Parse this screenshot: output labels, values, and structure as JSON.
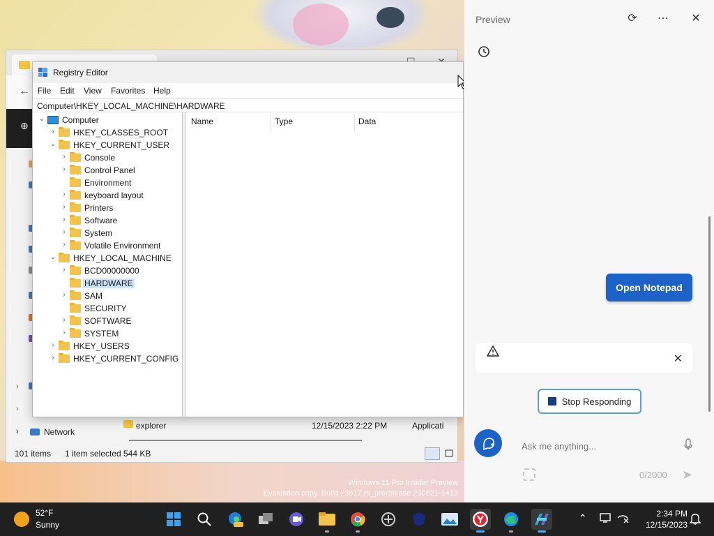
{
  "desktop": {
    "watermark_line1": "Windows 11 Pro Insider Preview",
    "watermark_line2": "Evaluation copy. Build 23617.rs_prerelease.230821-1413"
  },
  "explorer": {
    "sidebar_network": "Network",
    "file": {
      "name": "explorer",
      "date": "12/15/2023 2:22 PM",
      "type": "Applicati"
    },
    "status_items": "101 items",
    "status_selected": "1 item selected",
    "status_size": "544 KB"
  },
  "regedit": {
    "title": "Registry Editor",
    "menu": [
      "File",
      "Edit",
      "View",
      "Favorites",
      "Help"
    ],
    "address": "Computer\\HKEY_LOCAL_MACHINE\\HARDWARE",
    "columns": [
      "Name",
      "Type",
      "Data"
    ],
    "tree": [
      {
        "label": "Computer",
        "level": 0,
        "expanded": true,
        "icon": "computer"
      },
      {
        "label": "HKEY_CLASSES_ROOT",
        "level": 1,
        "expanded": false
      },
      {
        "label": "HKEY_CURRENT_USER",
        "level": 1,
        "expanded": true
      },
      {
        "label": "Console",
        "level": 2,
        "expanded": false
      },
      {
        "label": "Control Panel",
        "level": 2,
        "expanded": false
      },
      {
        "label": "Environment",
        "level": 2,
        "leaf": true
      },
      {
        "label": "keyboard layout",
        "level": 2,
        "expanded": false
      },
      {
        "label": "Printers",
        "level": 2,
        "expanded": false
      },
      {
        "label": "Software",
        "level": 2,
        "expanded": false
      },
      {
        "label": "System",
        "level": 2,
        "expanded": false
      },
      {
        "label": "Volatile Environment",
        "level": 2,
        "expanded": false
      },
      {
        "label": "HKEY_LOCAL_MACHINE",
        "level": 1,
        "expanded": true
      },
      {
        "label": "BCD00000000",
        "level": 2,
        "expanded": false
      },
      {
        "label": "HARDWARE",
        "level": 2,
        "leaf": true,
        "selected": true
      },
      {
        "label": "SAM",
        "level": 2,
        "expanded": false
      },
      {
        "label": "SECURITY",
        "level": 2,
        "leaf": true
      },
      {
        "label": "SOFTWARE",
        "level": 2,
        "expanded": false
      },
      {
        "label": "SYSTEM",
        "level": 2,
        "expanded": false
      },
      {
        "label": "HKEY_USERS",
        "level": 1,
        "expanded": false
      },
      {
        "label": "HKEY_CURRENT_CONFIG",
        "level": 1,
        "expanded": false
      }
    ]
  },
  "panel": {
    "title": "Preview",
    "refresh_icon": "refresh-icon",
    "more_icon": "more-icon",
    "close_icon": "close-icon",
    "open_notepad": "Open Notepad",
    "stop_responding": "Stop Responding",
    "input_placeholder": "Ask me anything...",
    "counter": "0/2000"
  },
  "taskbar": {
    "temperature": "52°F",
    "condition": "Sunny",
    "time": "2:34 PM",
    "date": "12/15/2023",
    "apps": [
      "start",
      "search",
      "edge-beta",
      "task-view",
      "teams",
      "file-explorer",
      "chrome",
      "app-grid",
      "vpn",
      "photos",
      "yandex",
      "edge",
      "copilot"
    ]
  },
  "colors": {
    "accent": "#1d63c7",
    "taskbar": "#202020",
    "selection": "#cce4f7",
    "folder": "#f2c44e"
  }
}
